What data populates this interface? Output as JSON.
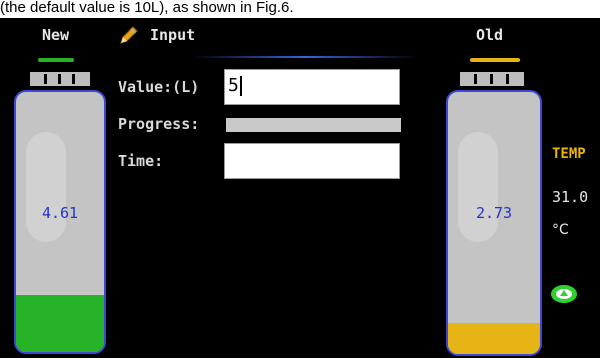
{
  "caption": "(the default value is 10L), as shown in Fig.6.",
  "header": {
    "new_label": "New",
    "input_label": "Input",
    "old_label": "Old"
  },
  "batteries": {
    "new": {
      "value": "4.61",
      "level": 0.22,
      "fill_color": "#27b327"
    },
    "old": {
      "value": "2.73",
      "level": 0.12,
      "fill_color": "#e6b415"
    }
  },
  "form": {
    "value_label": "Value:(L)",
    "value_input": "5",
    "progress_label": "Progress:",
    "progress": 0,
    "time_label": "Time:",
    "time_input": ""
  },
  "temperature": {
    "title": "TEMP",
    "value": "31.0",
    "unit": "°C"
  },
  "colors": {
    "new_accent": "#27b327",
    "old_accent": "#e6b415",
    "battery_border": "#3d49d6",
    "value_text": "#2233cc"
  },
  "icons": [
    "pencil-icon",
    "status-eye-icon"
  ]
}
